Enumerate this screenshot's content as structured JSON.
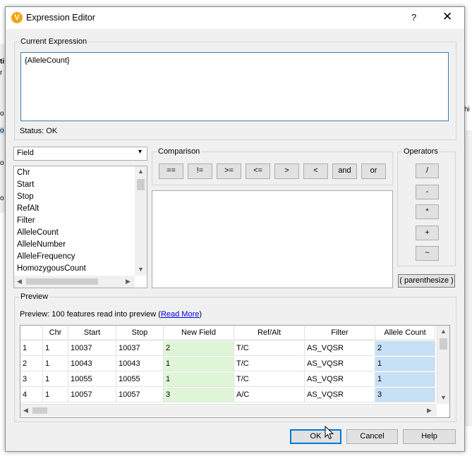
{
  "dialog": {
    "title": "Expression Editor",
    "help_label": "?",
    "close_label": "✕",
    "app_icon_letter": "V"
  },
  "background": {
    "fragments": [
      "ti",
      "r",
      "o",
      "o",
      "o",
      "o",
      "hi"
    ]
  },
  "current_expression": {
    "legend": "Current Expression",
    "value": "{AlleleCount}",
    "status": "Status: OK"
  },
  "field_select": {
    "selected": "Field"
  },
  "fields": [
    "Chr",
    "Start",
    "Stop",
    "RefAlt",
    "Filter",
    "AlleleCount",
    "AlleleNumber",
    "AlleleFrequency",
    "HomozygousCount"
  ],
  "comparison": {
    "legend": "Comparison",
    "buttons": [
      "==",
      "!=",
      ">=",
      "<=",
      ">",
      "<",
      "and",
      "or"
    ]
  },
  "operators": {
    "legend": "Operators",
    "buttons": [
      "/",
      "-",
      "*",
      "+",
      "~"
    ],
    "parenthesize_label": "( parenthesize )"
  },
  "preview": {
    "legend": "Preview",
    "info_prefix": "Preview: 100 features read into preview (",
    "read_more": "Read More",
    "info_suffix": ")",
    "columns": [
      "",
      "Chr",
      "Start",
      "Stop",
      "New Field",
      "Ref/Alt",
      "Filter",
      "Allele Count"
    ],
    "rows": [
      [
        "1",
        "1",
        "10037",
        "10037",
        "2",
        "T/C",
        "AS_VQSR",
        "2"
      ],
      [
        "2",
        "1",
        "10043",
        "10043",
        "1",
        "T/C",
        "AS_VQSR",
        "1"
      ],
      [
        "3",
        "1",
        "10055",
        "10055",
        "1",
        "T/C",
        "AS_VQSR",
        "1"
      ],
      [
        "4",
        "1",
        "10057",
        "10057",
        "3",
        "A/C",
        "AS_VQSR",
        "3"
      ]
    ]
  },
  "footer": {
    "ok_label": "OK",
    "cancel_label": "Cancel",
    "help_label": "Help"
  },
  "colors": {
    "new_field_highlight": "#dff5d8",
    "selected_column_highlight": "#c6e0f5",
    "focus_border": "#0078d7"
  }
}
